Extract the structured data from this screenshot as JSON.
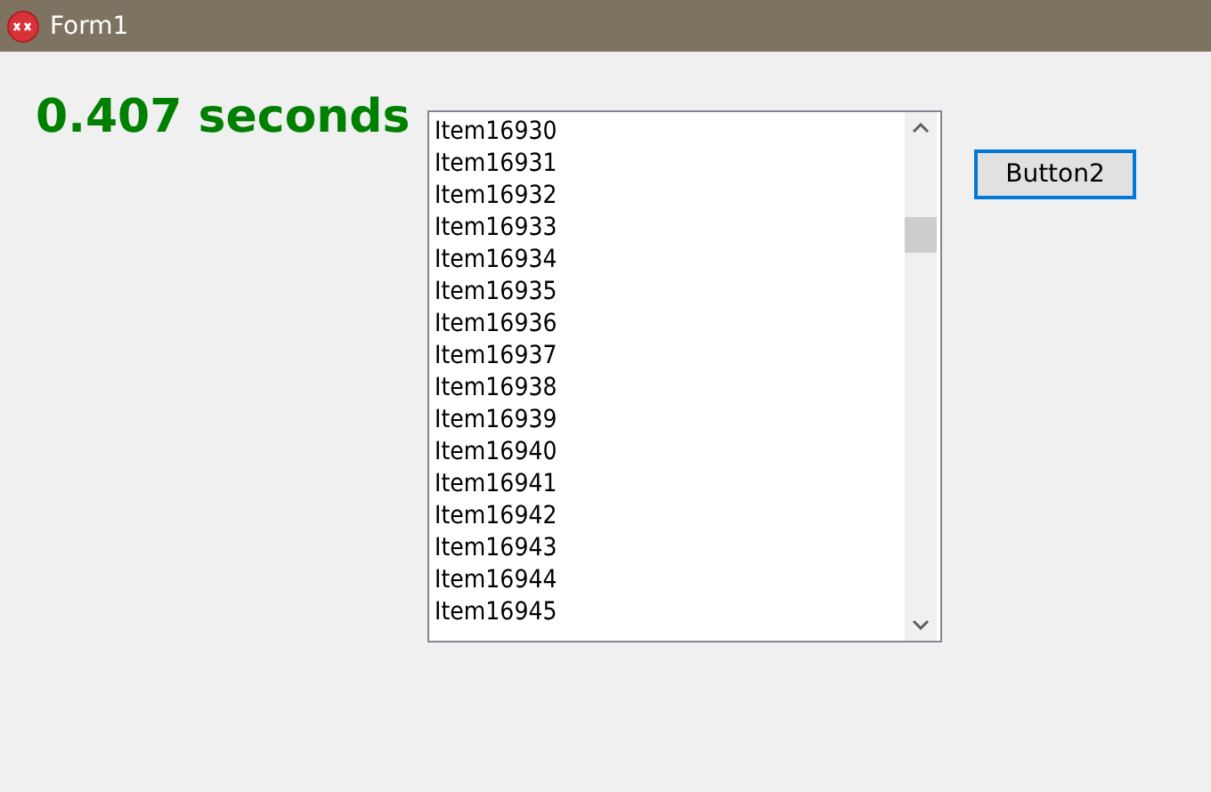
{
  "window": {
    "title": "Form1"
  },
  "timing_label": "0.407 seconds",
  "listbox": {
    "items": [
      "Item16930",
      "Item16931",
      "Item16932",
      "Item16933",
      "Item16934",
      "Item16935",
      "Item16936",
      "Item16937",
      "Item16938",
      "Item16939",
      "Item16940",
      "Item16941",
      "Item16942",
      "Item16943",
      "Item16944",
      "Item16945"
    ]
  },
  "buttons": [
    {
      "label": "Button2",
      "focused": true
    }
  ]
}
